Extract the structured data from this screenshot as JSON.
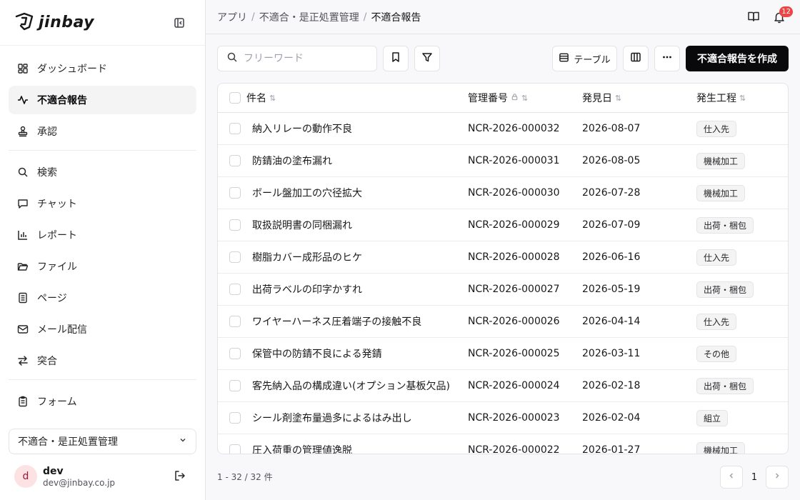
{
  "app": {
    "logo_text": "jinbay"
  },
  "sidebar": {
    "items": [
      {
        "label": "ダッシュボード",
        "icon": "dashboard-icon",
        "active": false
      },
      {
        "label": "不適合報告",
        "icon": "activity-icon",
        "active": true
      },
      {
        "label": "承認",
        "icon": "stamp-icon",
        "active": false
      }
    ],
    "items2": [
      {
        "label": "検索",
        "icon": "search-icon"
      },
      {
        "label": "チャット",
        "icon": "chat-icon"
      },
      {
        "label": "レポート",
        "icon": "bar-chart-icon"
      },
      {
        "label": "ファイル",
        "icon": "folder-icon"
      },
      {
        "label": "ページ",
        "icon": "page-icon"
      },
      {
        "label": "メール配信",
        "icon": "mail-icon"
      },
      {
        "label": "突合",
        "icon": "swap-icon"
      }
    ],
    "items3": [
      {
        "label": "フォーム",
        "icon": "clipboard-icon"
      }
    ],
    "org_select": "不適合・是正処置管理",
    "user": {
      "initial": "d",
      "name": "dev",
      "email": "dev@jinbay.co.jp"
    }
  },
  "header": {
    "breadcrumb": [
      "アプリ",
      "不適合・是正処置管理",
      "不適合報告"
    ],
    "notification_count": "12"
  },
  "toolbar": {
    "search_placeholder": "フリーワード",
    "view_label": "テーブル",
    "create_label": "不適合報告を作成"
  },
  "table": {
    "columns": [
      "件名",
      "管理番号",
      "発見日",
      "発生工程"
    ],
    "rows": [
      {
        "title": "納入リレーの動作不良",
        "id": "NCR-2026-000032",
        "date": "2026-08-07",
        "process": "仕入先"
      },
      {
        "title": "防錆油の塗布漏れ",
        "id": "NCR-2026-000031",
        "date": "2026-08-05",
        "process": "機械加工"
      },
      {
        "title": "ボール盤加工の穴径拡大",
        "id": "NCR-2026-000030",
        "date": "2026-07-28",
        "process": "機械加工"
      },
      {
        "title": "取扱説明書の同梱漏れ",
        "id": "NCR-2026-000029",
        "date": "2026-07-09",
        "process": "出荷・梱包"
      },
      {
        "title": "樹脂カバー成形品のヒケ",
        "id": "NCR-2026-000028",
        "date": "2026-06-16",
        "process": "仕入先"
      },
      {
        "title": "出荷ラベルの印字かすれ",
        "id": "NCR-2026-000027",
        "date": "2026-05-19",
        "process": "出荷・梱包"
      },
      {
        "title": "ワイヤーハーネス圧着端子の接触不良",
        "id": "NCR-2026-000026",
        "date": "2026-04-14",
        "process": "仕入先"
      },
      {
        "title": "保管中の防錆不良による発錆",
        "id": "NCR-2026-000025",
        "date": "2026-03-11",
        "process": "その他"
      },
      {
        "title": "客先納入品の構成違い(オプション基板欠品)",
        "id": "NCR-2026-000024",
        "date": "2026-02-18",
        "process": "出荷・梱包"
      },
      {
        "title": "シール剤塗布量過多によるはみ出し",
        "id": "NCR-2026-000023",
        "date": "2026-02-04",
        "process": "組立"
      },
      {
        "title": "圧入荷重の管理値逸脱",
        "id": "NCR-2026-000022",
        "date": "2026-01-27",
        "process": "機械加工"
      }
    ]
  },
  "footer": {
    "count_text": "1 - 32 / 32 件",
    "page": "1"
  }
}
